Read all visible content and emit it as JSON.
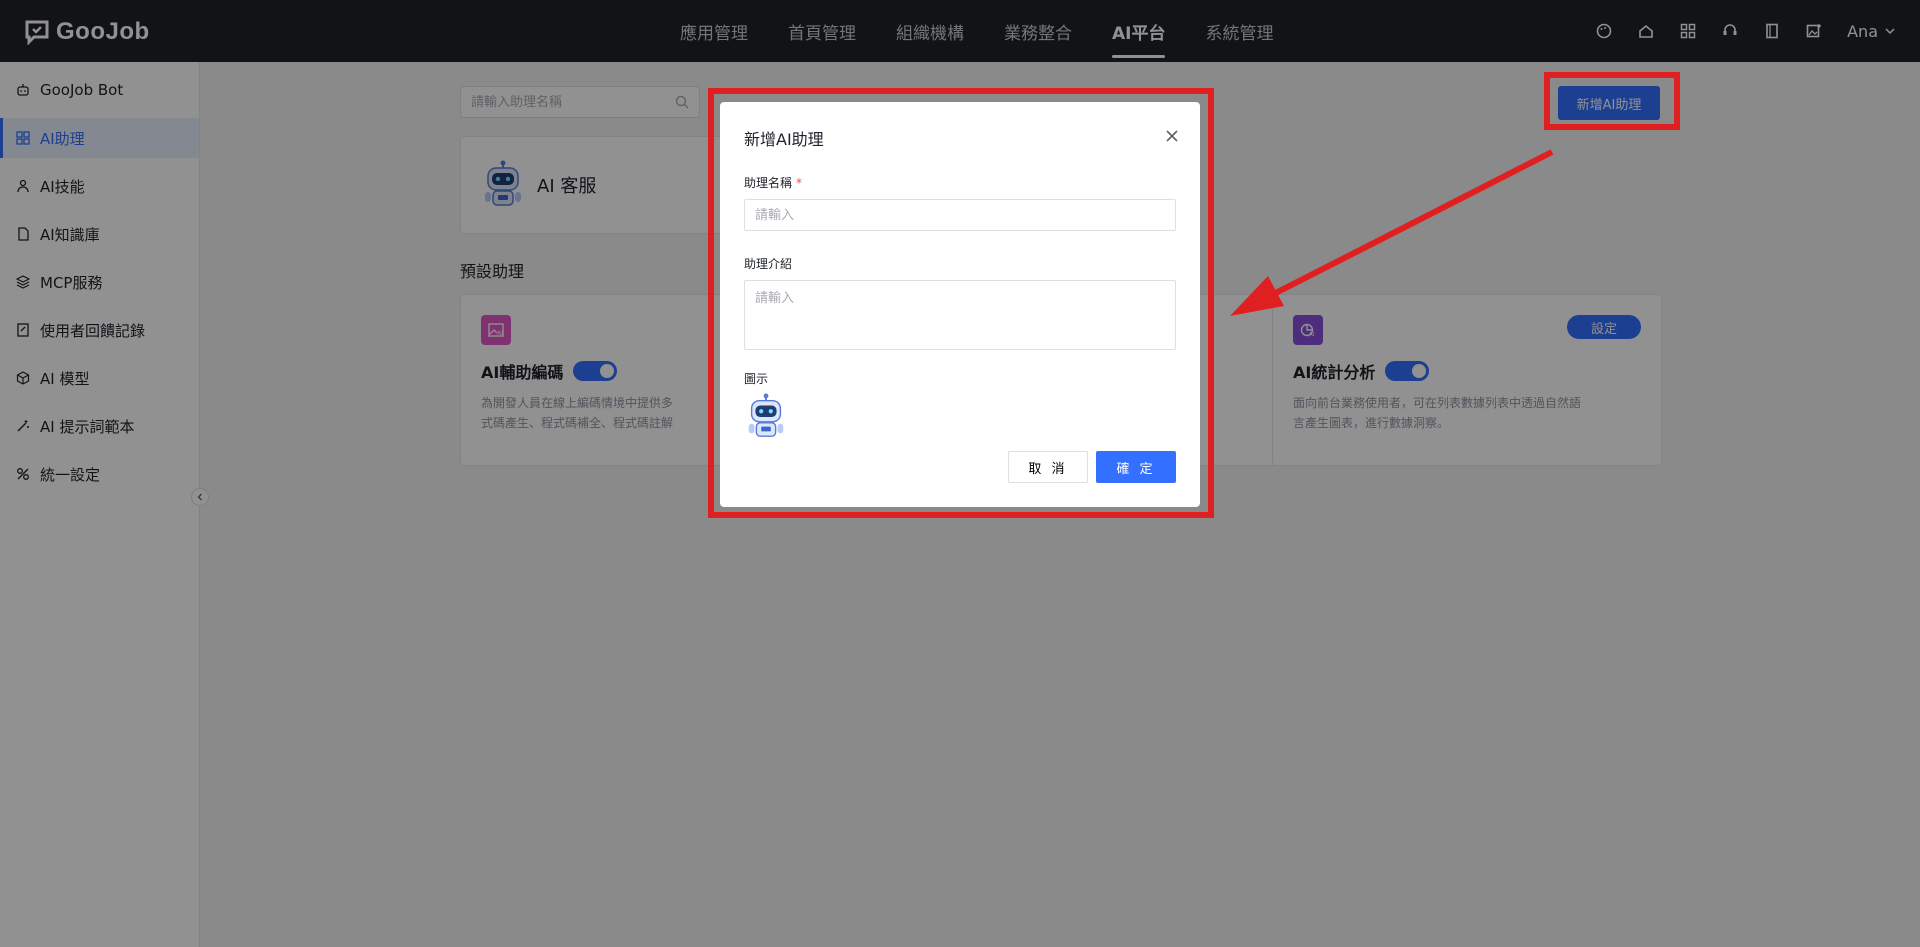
{
  "brand": {
    "name": "GooJob"
  },
  "topnav": {
    "items": [
      {
        "label": "應用管理",
        "active": false
      },
      {
        "label": "首頁管理",
        "active": false
      },
      {
        "label": "組織機構",
        "active": false
      },
      {
        "label": "業務整合",
        "active": false
      },
      {
        "label": "AI平台",
        "active": true
      },
      {
        "label": "系統管理",
        "active": false
      }
    ],
    "icons": [
      "palette-icon",
      "home-icon",
      "apps-grid-icon",
      "support-icon",
      "book-icon",
      "image-add-icon"
    ],
    "user": "Ana"
  },
  "sidebar": {
    "items": [
      {
        "label": "GooJob Bot",
        "icon": "robot-icon",
        "active": false
      },
      {
        "label": "AI助理",
        "icon": "grid-icon",
        "active": true
      },
      {
        "label": "AI技能",
        "icon": "skills-icon",
        "active": false
      },
      {
        "label": "AI知識庫",
        "icon": "document-icon",
        "active": false
      },
      {
        "label": "MCP服務",
        "icon": "layers-icon",
        "active": false
      },
      {
        "label": "使用者回饋記錄",
        "icon": "feedback-icon",
        "active": false
      },
      {
        "label": "AI 模型",
        "icon": "cube-icon",
        "active": false
      },
      {
        "label": "AI 提示詞範本",
        "icon": "wand-icon",
        "active": false
      },
      {
        "label": "統一設定",
        "icon": "settings-icon",
        "active": false
      }
    ]
  },
  "main": {
    "search_placeholder": "請輸入助理名稱",
    "add_button": "新增AI助理",
    "customer_service": {
      "title": "AI 客服"
    },
    "preset_section_title": "預設助理",
    "presets": [
      {
        "title": "AI輔助編碼",
        "desc_line1": "為開發人員在線上編碼情境中提供多",
        "desc_line2": "式碼產生、程式碼補全、程式碼註解",
        "icon_color": "#e056c6",
        "enabled": true
      },
      {
        "title": "AI統計分析",
        "desc_line1": "面向前台業務使用者，可在列表數據列表中透過自然語",
        "desc_line2": "言產生圖表，進行數據洞察。",
        "icon_color": "#8a4fe0",
        "enabled": true,
        "set_label": "設定"
      }
    ]
  },
  "modal": {
    "title": "新增AI助理",
    "name_label": "助理名稱",
    "name_required": "*",
    "name_placeholder": "請輸入",
    "intro_label": "助理介紹",
    "intro_placeholder": "請輸入",
    "icon_label": "圖示",
    "cancel_label": "取 消",
    "ok_label": "確 定"
  },
  "colors": {
    "primary": "#3370ff",
    "topbar": "#1f2329",
    "annotation": "#e02020"
  }
}
